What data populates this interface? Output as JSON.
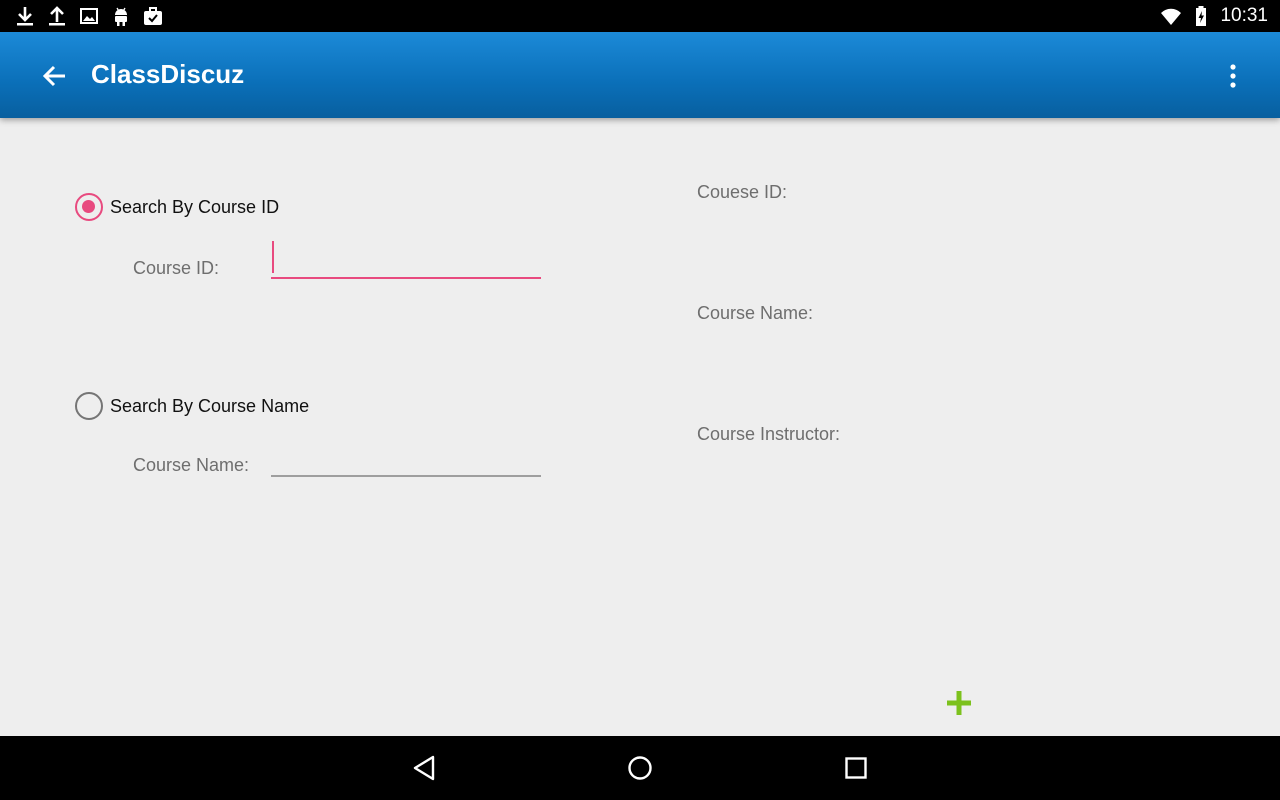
{
  "status_bar": {
    "time": "10:31",
    "left_icons": [
      "download-icon",
      "upload-icon",
      "image-icon",
      "android-icon",
      "briefcase-icon"
    ],
    "right_icons": [
      "wifi-icon",
      "battery-charging-icon"
    ]
  },
  "app_bar": {
    "title": "ClassDiscuz",
    "color": "#0a73bf"
  },
  "search": {
    "by_id": {
      "label": "Search By Course ID",
      "checked": true,
      "field_label": "Course ID:",
      "value": ""
    },
    "by_name": {
      "label": "Search By Course Name",
      "checked": false,
      "field_label": "Course Name:",
      "value": ""
    }
  },
  "details": {
    "course_id_label": "Couese ID:",
    "course_name_label": "Course Name:",
    "instructor_label": "Course Instructor:"
  },
  "accent_color": "#e84a7f",
  "add_button_color": "#7cc11d"
}
